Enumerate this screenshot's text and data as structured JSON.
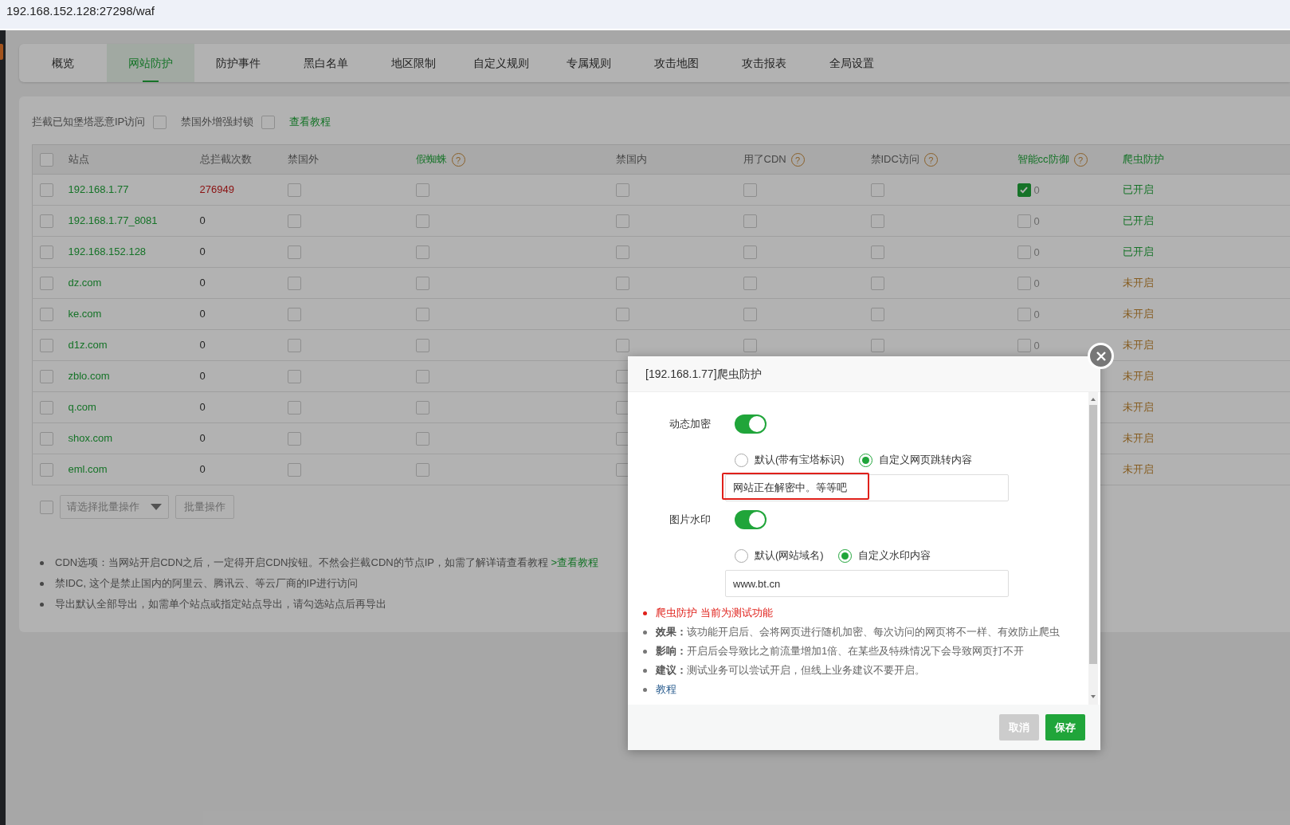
{
  "address_bar": {
    "url": "192.168.152.128:27298/waf"
  },
  "tabs": [
    {
      "label": "概览",
      "selected": false
    },
    {
      "label": "网站防护",
      "selected": true
    },
    {
      "label": "防护事件",
      "selected": false
    },
    {
      "label": "黑白名单",
      "selected": false
    },
    {
      "label": "地区限制",
      "selected": false
    },
    {
      "label": "自定义规则",
      "selected": false
    },
    {
      "label": "专属规则",
      "selected": false
    },
    {
      "label": "攻击地图",
      "selected": false
    },
    {
      "label": "攻击报表",
      "selected": false
    },
    {
      "label": "全局设置",
      "selected": false
    }
  ],
  "options": {
    "items": [
      {
        "label": "拦截已知堡塔恶意IP访问",
        "checked": false
      },
      {
        "label": "禁国外增强封锁",
        "checked": false
      }
    ],
    "link": "查看教程"
  },
  "table": {
    "header_checked": false,
    "columns": [
      {
        "label": "站点",
        "highlight": false
      },
      {
        "label": "总拦截次数",
        "highlight": false
      },
      {
        "label": "禁国外",
        "highlight": false
      },
      {
        "label": "假蜘蛛",
        "highlight": true,
        "help": "?"
      },
      {
        "label": "禁国内",
        "highlight": false
      },
      {
        "label": "用了CDN",
        "highlight": false,
        "help": "?"
      },
      {
        "label": "禁IDC访问",
        "highlight": false,
        "help": "?"
      },
      {
        "label": "智能cc防御",
        "highlight": true,
        "help": "?"
      },
      {
        "label": "爬虫防护",
        "highlight": true
      }
    ],
    "rows": [
      {
        "checked": false,
        "site": "192.168.1.77",
        "count": "276949",
        "count_alert": true,
        "ban_foreign": false,
        "fake_spider": false,
        "ban_domestic": false,
        "cdn": false,
        "ban_idc": false,
        "cc": {
          "checked": true,
          "count": "0"
        },
        "crawler": {
          "text": "已开启",
          "on": true
        }
      },
      {
        "checked": false,
        "site": "192.168.1.77_8081",
        "count": "0",
        "count_alert": false,
        "ban_foreign": false,
        "fake_spider": false,
        "ban_domestic": false,
        "cdn": false,
        "ban_idc": false,
        "cc": {
          "checked": false,
          "count": "0"
        },
        "crawler": {
          "text": "已开启",
          "on": true
        }
      },
      {
        "checked": false,
        "site": "192.168.152.128",
        "count": "0",
        "count_alert": false,
        "ban_foreign": false,
        "fake_spider": false,
        "ban_domestic": false,
        "cdn": false,
        "ban_idc": false,
        "cc": {
          "checked": false,
          "count": "0"
        },
        "crawler": {
          "text": "已开启",
          "on": true
        }
      },
      {
        "checked": false,
        "site": "dz.com",
        "count": "0",
        "count_alert": false,
        "ban_foreign": false,
        "fake_spider": false,
        "ban_domestic": false,
        "cdn": false,
        "ban_idc": false,
        "cc": {
          "checked": false,
          "count": "0"
        },
        "crawler": {
          "text": "未开启",
          "on": false
        }
      },
      {
        "checked": false,
        "site": "ke.com",
        "count": "0",
        "count_alert": false,
        "ban_foreign": false,
        "fake_spider": false,
        "ban_domestic": false,
        "cdn": false,
        "ban_idc": false,
        "cc": {
          "checked": false,
          "count": "0"
        },
        "crawler": {
          "text": "未开启",
          "on": false
        }
      },
      {
        "checked": false,
        "site": "d1z.com",
        "count": "0",
        "count_alert": false,
        "ban_foreign": false,
        "fake_spider": false,
        "ban_domestic": false,
        "cdn": false,
        "ban_idc": false,
        "cc": {
          "checked": false,
          "count": "0"
        },
        "crawler": {
          "text": "未开启",
          "on": false
        }
      },
      {
        "checked": false,
        "site": "zblo.com",
        "count": "0",
        "count_alert": false,
        "ban_foreign": false,
        "fake_spider": false,
        "ban_domestic": false,
        "crawler": {
          "text": "未开启",
          "on": false
        }
      },
      {
        "checked": false,
        "site": "q.com",
        "count": "0",
        "count_alert": false,
        "ban_foreign": false,
        "fake_spider": false,
        "ban_domestic": false,
        "crawler": {
          "text": "未开启",
          "on": false
        }
      },
      {
        "checked": false,
        "site": "shox.com",
        "count": "0",
        "count_alert": false,
        "ban_foreign": false,
        "fake_spider": false,
        "ban_domestic": false,
        "crawler": {
          "text": "未开启",
          "on": false
        }
      },
      {
        "checked": false,
        "site": "eml.com",
        "count": "0",
        "count_alert": false,
        "ban_foreign": false,
        "fake_spider": false,
        "ban_domestic": false,
        "crawler": {
          "text": "未开启",
          "on": false
        }
      }
    ]
  },
  "batch": {
    "checked": false,
    "select_placeholder": "请选择批量操作",
    "button": "批量操作"
  },
  "notes": [
    {
      "text": "CDN选项：当网站开启CDN之后，一定得开启CDN按钮。不然会拦截CDN的节点IP，如需了解详请查看教程 ",
      "link": ">查看教程"
    },
    {
      "text": "禁IDC, 这个是禁止国内的阿里云、腾讯云、等云厂商的IP进行访问"
    },
    {
      "text": "导出默认全部导出，如需单个站点或指定站点导出，请勾选站点后再导出"
    }
  ],
  "modal": {
    "title": "[192.168.1.77]爬虫防护",
    "sections": [
      {
        "label": "动态加密",
        "on": true,
        "options": [
          {
            "label": "默认(带有宝塔标识)",
            "selected": false
          },
          {
            "label": "自定义网页跳转内容",
            "selected": true
          }
        ],
        "value": "网站正在解密中。等等吧",
        "highlighted": true
      },
      {
        "label": "图片水印",
        "on": true,
        "options": [
          {
            "label": "默认(网站域名)",
            "selected": false
          },
          {
            "label": "自定义水印内容",
            "selected": true
          }
        ],
        "value": "www.bt.cn",
        "highlighted": false
      }
    ],
    "notes": [
      {
        "kind": "warning",
        "text": "爬虫防护 当前为测试功能"
      },
      {
        "kind": "info",
        "text": "**效果：**该功能开启后、会将网页进行随机加密、每次访问的网页将不一样、有效防止爬虫"
      },
      {
        "kind": "info",
        "text": "**影响：**开启后会导致比之前流量增加1倍、在某些及特殊情况下会导致网页打不开"
      },
      {
        "kind": "info",
        "text": "**建议：**测试业务可以尝试开启，但线上业务建议不要开启。"
      },
      {
        "kind": "link",
        "text": "教程"
      }
    ],
    "buttons": [
      {
        "label": "取消",
        "kind": "secondary"
      },
      {
        "label": "保存",
        "kind": "primary"
      }
    ]
  }
}
